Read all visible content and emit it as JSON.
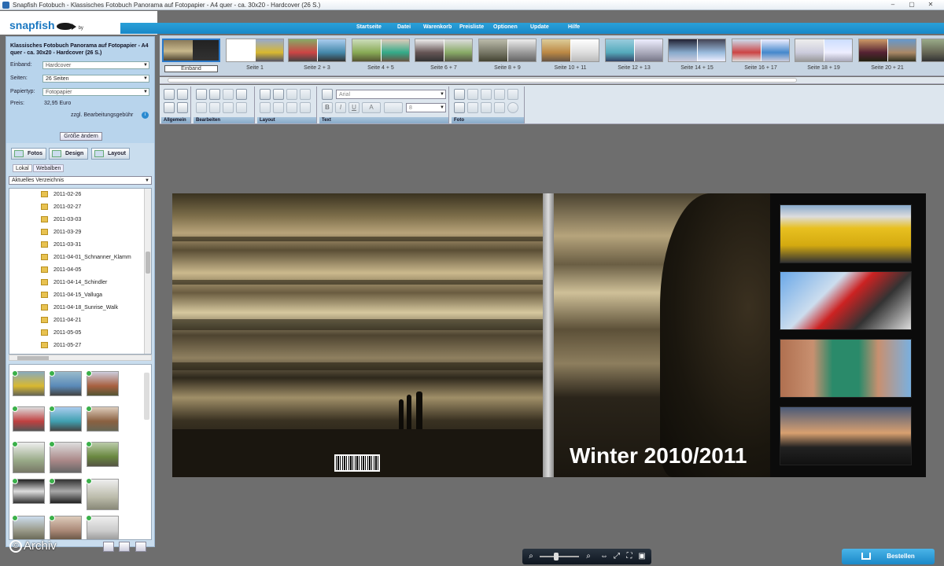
{
  "window": {
    "title": "Snapfish Fotobuch - Klassisches Fotobuch Panorama auf Fotopapier - A4 quer - ca. 30x20 - Hardcover (26 S.)",
    "minimize": "–",
    "maximize": "▢",
    "close": "✕"
  },
  "brand": {
    "logo": "snapfish",
    "by": "by"
  },
  "menu": [
    "Startseite",
    "Datei",
    "Warenkorb",
    "Preisliste",
    "Optionen",
    "Update",
    "Hilfe"
  ],
  "book": {
    "title": "Klassisches Fotobuch Panorama auf Fotopapier - A4 quer - ca. 30x20 - Hardcover (26 S.)",
    "fields": [
      {
        "label": "Einband:",
        "value": "Hardcover"
      },
      {
        "label": "Seiten:",
        "value": "26 Seiten"
      },
      {
        "label": "Papiertyp:",
        "value": "Fotopapier"
      }
    ],
    "price_label": "Preis:",
    "price_value": "32,95 Euro",
    "fee_note": "zzgl. Bearbeitungsgebühr",
    "resize_button": "Größe ändern"
  },
  "panel_tabs": [
    "Fotos",
    "Design",
    "Layout"
  ],
  "source_tabs": [
    "Lokal",
    "Webalben"
  ],
  "directory": "Aktuelles Verzeichnis",
  "folders": [
    "2011-02-26",
    "2011-02-27",
    "2011-03-03",
    "2011-03-29",
    "2011-03-31",
    "2011-04-01_Schnanner_Klamm",
    "2011-04-05",
    "2011-04-14_Schindler",
    "2011-04-15_Valluga",
    "2011-04-18_Sunrise_Walk",
    "2011-04-21",
    "2011-05-05",
    "2011-05-27"
  ],
  "page_strip": [
    "Einband",
    "Seite 1",
    "Seite 2 + 3",
    "Seite 4 + 5",
    "Seite 6 + 7",
    "Seite 8 + 9",
    "Seite 10 + 11",
    "Seite 12 + 13",
    "Seite 14 + 15",
    "Seite 16 + 17",
    "Seite 18 + 19",
    "Seite 20 + 21"
  ],
  "toolbar_groups": [
    "Allgemein",
    "Bearbeiten",
    "Layout",
    "Text",
    "Foto"
  ],
  "text_tools": {
    "font": "Arial",
    "size": "8",
    "bold": "B",
    "italic": "I",
    "underline": "U",
    "color": "A"
  },
  "cover": {
    "title": "Winter 2010/2011"
  },
  "watermark": "Archiv",
  "copyright": "©",
  "order_button": "Bestellen",
  "colors": {
    "menubar": "#1f95d2",
    "accent": "#1b78c1",
    "check": "#3bb04a"
  }
}
